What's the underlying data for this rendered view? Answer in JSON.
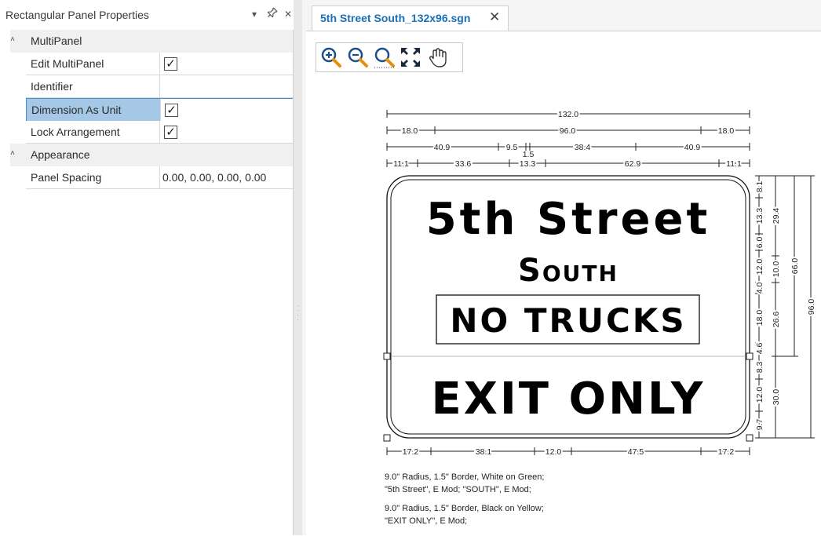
{
  "panel": {
    "title": "Rectangular Panel Properties",
    "dropdown_icon": "▾",
    "pin_icon": "✶",
    "close_icon": "✕"
  },
  "grid": {
    "categories": [
      {
        "label": "MultiPanel",
        "properties": [
          {
            "name": "Edit MultiPanel",
            "checked": true
          },
          {
            "name": "Identifier",
            "value": ""
          },
          {
            "name": "Dimension As Unit",
            "checked": true
          },
          {
            "name": "Lock Arrangement",
            "checked": true
          }
        ]
      },
      {
        "label": "Appearance",
        "properties": [
          {
            "name": "Panel Spacing",
            "value": "0.00, 0.00, 0.00, 0.00"
          }
        ]
      }
    ],
    "check_glyph": "✓"
  },
  "document": {
    "tab_title": "5th Street South_132x96.sgn",
    "tab_close": "✕"
  },
  "toolbar": {
    "icons": [
      "zoom-in-icon",
      "zoom-out-icon",
      "zoom-fit-icon",
      "fullscreen-icon",
      "pan-hand-icon"
    ]
  },
  "sign": {
    "line1": "5th Street",
    "line2": "South",
    "line3": "NO TRUCKS",
    "line4": "EXIT ONLY"
  },
  "dimensions": {
    "overall_width": "132.0",
    "row2": [
      "18.0",
      "96.0",
      "18.0"
    ],
    "row3": [
      "40.9",
      "9.5",
      "1.5",
      "38.4",
      "40.9"
    ],
    "row4": [
      "11.1",
      "33.6",
      "13.3",
      "62.9",
      "11.1"
    ],
    "bottom": [
      "17.2",
      "38.1",
      "12.0",
      "47.5",
      "17.2"
    ],
    "right_a": [
      "8.1",
      "13.3",
      "6.0",
      "12.0",
      "4.0",
      "18.0",
      "4.6",
      "8.3",
      "12.0",
      "9.7"
    ],
    "right_b": [
      "29.4",
      "10.0",
      "26.6",
      "30.0"
    ],
    "right_c": "66.0",
    "right_d": "96.0"
  },
  "notes": {
    "n1a": "9.0\" Radius, 1.5\" Border, White on Green;",
    "n1b": "\"5th Street\",   E Mod; \"SOUTH\",   E Mod;",
    "n2a": "9.0\" Radius, 1.5\" Border, Black on Yellow;",
    "n2b": "\"EXIT ONLY\",   E Mod;"
  },
  "colors": {
    "selection": "#a4c8e6",
    "tab_text": "#1a6fb5",
    "zoom_orange": "#e8900c",
    "zoom_blue": "#1a4f8a"
  }
}
